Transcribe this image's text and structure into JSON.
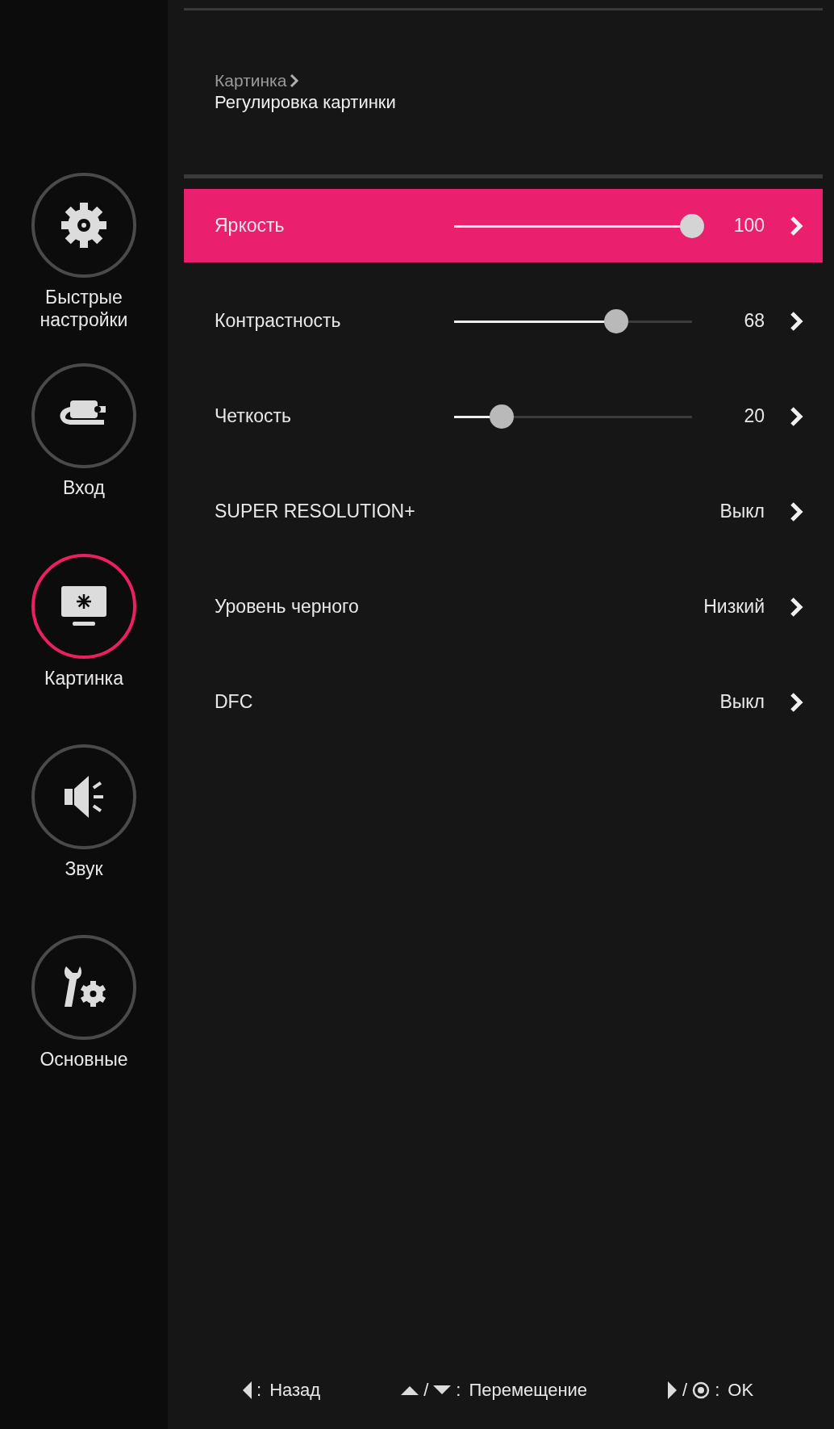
{
  "sidebar": {
    "items": [
      {
        "label": "Быстрые настройки",
        "selected": false
      },
      {
        "label": "Вход",
        "selected": false
      },
      {
        "label": "Картинка",
        "selected": true
      },
      {
        "label": "Звук",
        "selected": false
      },
      {
        "label": "Основные",
        "selected": false
      }
    ]
  },
  "header": {
    "breadcrumb": "Картинка",
    "title": "Регулировка картинки"
  },
  "settings": [
    {
      "kind": "slider",
      "label": "Яркость",
      "level": 1.0,
      "value": "100",
      "selected": true
    },
    {
      "kind": "slider",
      "label": "Контрастность",
      "level": 0.68,
      "value": "68",
      "selected": false
    },
    {
      "kind": "slider",
      "label": "Четкость",
      "level": 0.2,
      "value": "20",
      "selected": false
    },
    {
      "kind": "option",
      "label": "SUPER RESOLUTION+",
      "value": "Выкл",
      "selected": false
    },
    {
      "kind": "option",
      "label": "Уровень черного",
      "value": "Низкий",
      "selected": false
    },
    {
      "kind": "option",
      "label": "DFC",
      "value": "Выкл",
      "selected": false
    }
  ],
  "footer": {
    "hints": [
      {
        "kind": "back",
        "colon": ":",
        "label": "Назад"
      },
      {
        "kind": "move",
        "slash": "/",
        "colon": ":",
        "label": "Перемещение"
      },
      {
        "kind": "ok",
        "slash": "/",
        "colon": ":",
        "label": "OK"
      }
    ]
  }
}
